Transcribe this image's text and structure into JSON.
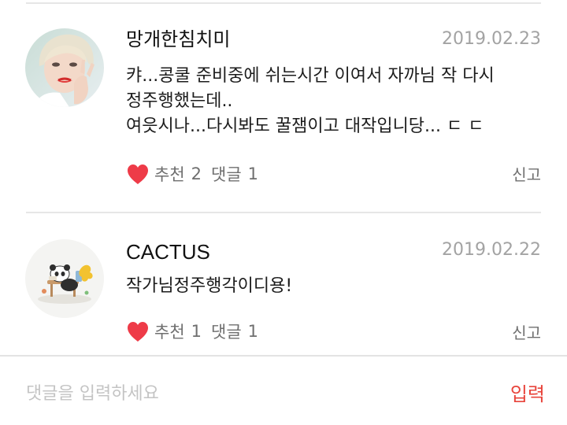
{
  "colors": {
    "accent_red": "#e8453c",
    "heart": "#ee3b48",
    "date_gray": "#a3a3a3",
    "action_gray": "#6f6f6f",
    "divider": "#e6e6e6"
  },
  "comments": [
    {
      "author": "망개한침치미",
      "date": "2019.02.23",
      "body_lines": [
        "캬...콩쿨 준비중에 쉬는시간 이여서 자까님 작 다시",
        "정주행했는데..",
        "여읏시나...다시봐도 꿀잼이고 대작입니당... ㄷ ㄷ"
      ],
      "like_label": "추천",
      "like_count": "2",
      "reply_label": "댓글",
      "reply_count": "1",
      "report_label": "신고",
      "avatar_icon": "user-photo-avatar",
      "like_icon": "heart-icon"
    },
    {
      "author": "CACTUS",
      "date": "2019.02.22",
      "body_lines": [
        "작가님정주행각이디용!"
      ],
      "like_label": "추천",
      "like_count": "1",
      "reply_label": "댓글",
      "reply_count": "1",
      "report_label": "신고",
      "avatar_icon": "panda-illustration-avatar",
      "like_icon": "heart-icon"
    }
  ],
  "input": {
    "placeholder": "댓글을 입력하세요",
    "value": "",
    "submit_label": "입력"
  }
}
